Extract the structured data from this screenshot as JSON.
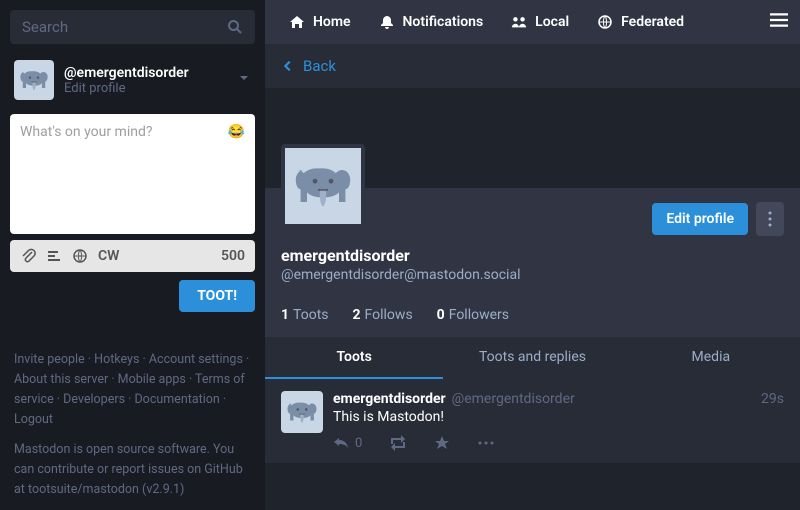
{
  "search": {
    "placeholder": "Search"
  },
  "account": {
    "handle": "@emergentdisorder",
    "edit_label": "Edit profile"
  },
  "compose": {
    "placeholder": "What's on your mind?",
    "cw_label": "CW",
    "char_limit": "500",
    "toot_button": "TOOT!"
  },
  "footer": {
    "links_line1": "Invite people · Hotkeys · Account settings · About this server · Mobile apps · Terms of service · Developers · Documentation · Logout",
    "about": "Mastodon is open source software. You can contribute or report issues on GitHub at tootsuite/mastodon (v2.9.1)"
  },
  "nav": {
    "home": "Home",
    "notifications": "Notifications",
    "local": "Local",
    "federated": "Federated"
  },
  "back": {
    "label": "Back"
  },
  "profile": {
    "edit_button": "Edit profile",
    "display_name": "emergentdisorder",
    "handle": "@emergentdisorder@mastodon.social",
    "stats": {
      "toots": {
        "count": "1",
        "label": "Toots"
      },
      "follows": {
        "count": "2",
        "label": "Follows"
      },
      "followers": {
        "count": "0",
        "label": "Followers"
      }
    }
  },
  "tabs": {
    "toots": "Toots",
    "replies": "Toots and replies",
    "media": "Media"
  },
  "feed": {
    "items": [
      {
        "name": "emergentdisorder",
        "handle": "@emergentdisorder",
        "time": "29s",
        "content": "This is Mastodon!",
        "reply_count": "0"
      }
    ]
  }
}
